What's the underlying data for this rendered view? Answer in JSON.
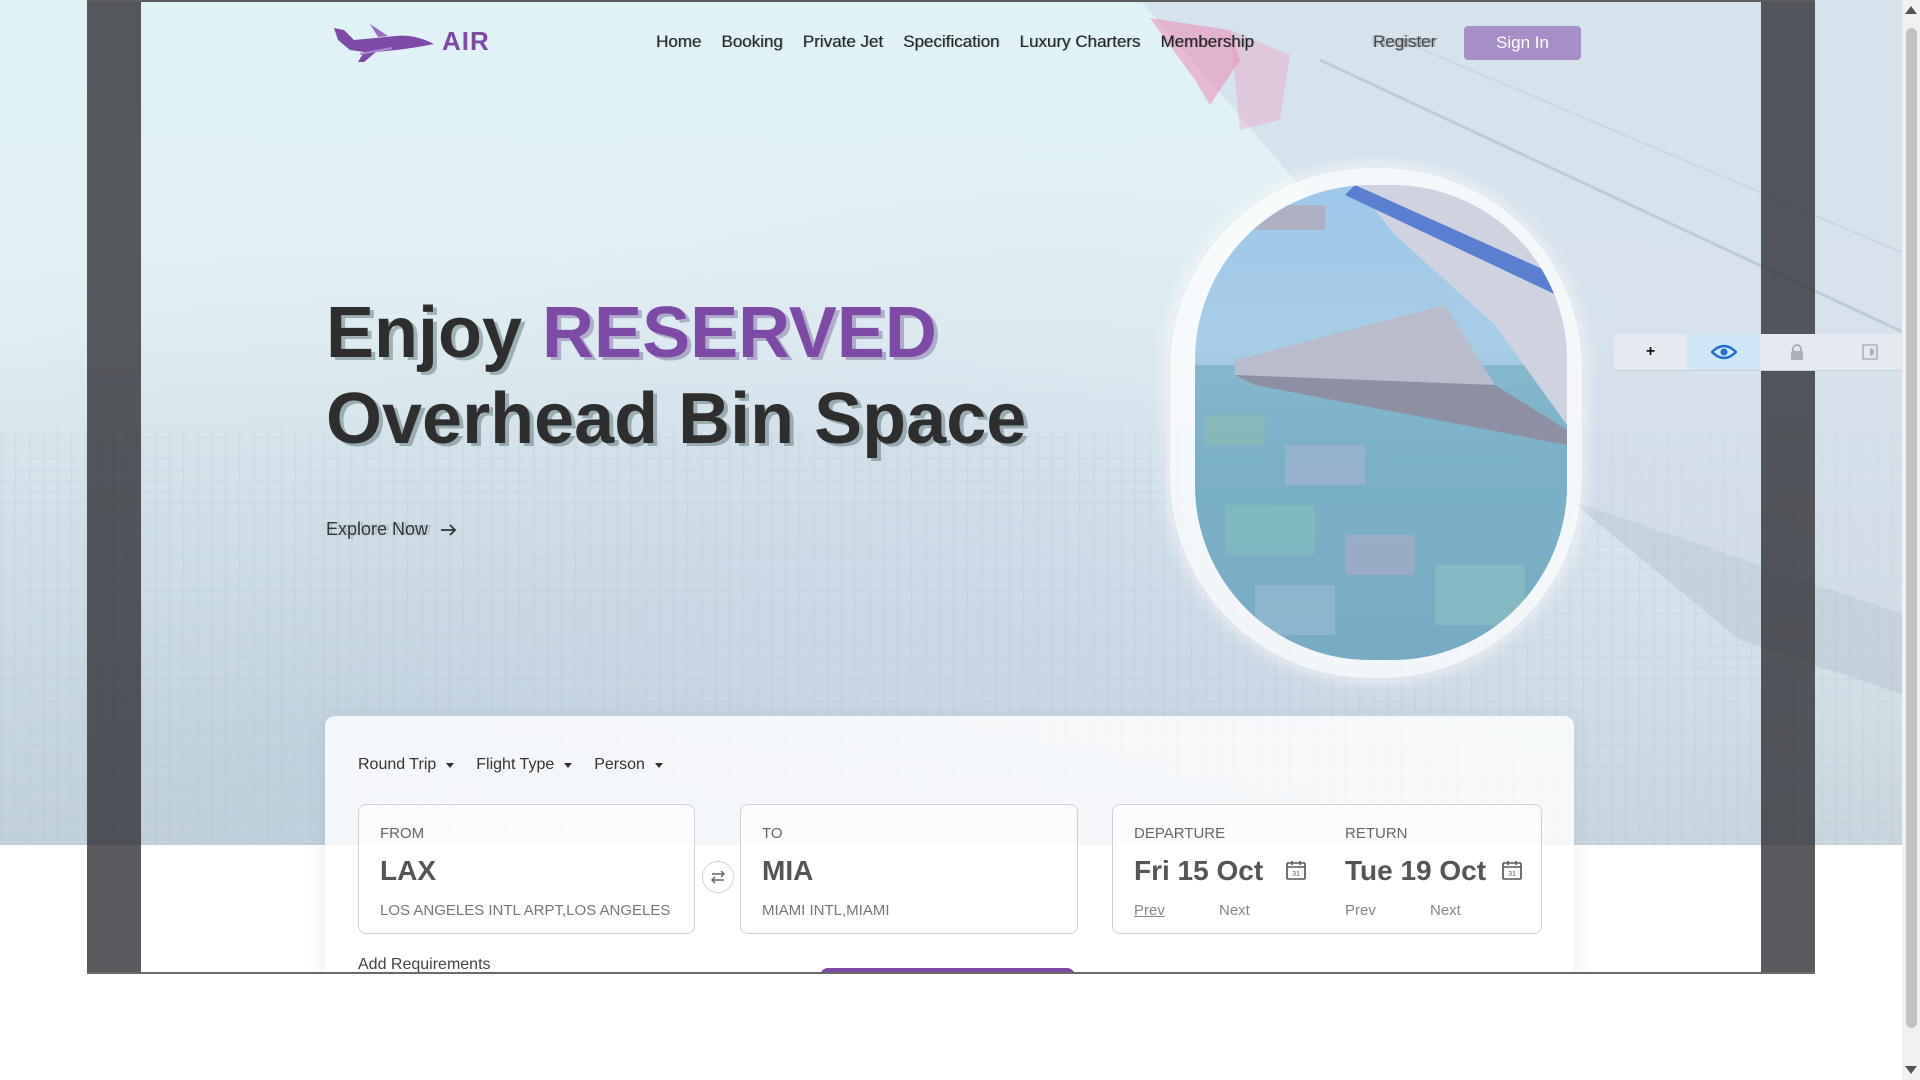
{
  "brand": {
    "logo_text": "AIR",
    "accent_color": "#7d4aa6"
  },
  "nav": {
    "items": [
      "Home",
      "Booking",
      "Private Jet",
      "Specification",
      "Luxury Charters",
      "Membership"
    ]
  },
  "auth": {
    "register": "Register",
    "sign_in": "Sign In"
  },
  "hero": {
    "title_word": "Enjoy",
    "title_accent": "RESERVED",
    "title_line2": "Overhead Bin Space",
    "cta": "Explore Now"
  },
  "side_toolbar": {
    "icons": [
      "plus-icon",
      "eye-icon",
      "lock-icon",
      "contrast-icon"
    ],
    "active": "eye-icon"
  },
  "booking": {
    "filters": [
      "Round Trip",
      "Flight Type",
      "Person"
    ],
    "from": {
      "label": "FROM",
      "code": "LAX",
      "airport": "LOS ANGELES INTL ARPT,LOS ANGELES"
    },
    "to": {
      "label": "TO",
      "code": "MIA",
      "airport": "MIAMI INTL,MIAMI"
    },
    "departure": {
      "label": "DEPARTURE",
      "date": "Fri 15 Oct",
      "prev": "Prev",
      "next": "Next"
    },
    "return": {
      "label": "RETURN",
      "date": "Tue 19 Oct",
      "prev": "Prev",
      "next": "Next"
    },
    "add_requirements": "Add Requirements"
  }
}
